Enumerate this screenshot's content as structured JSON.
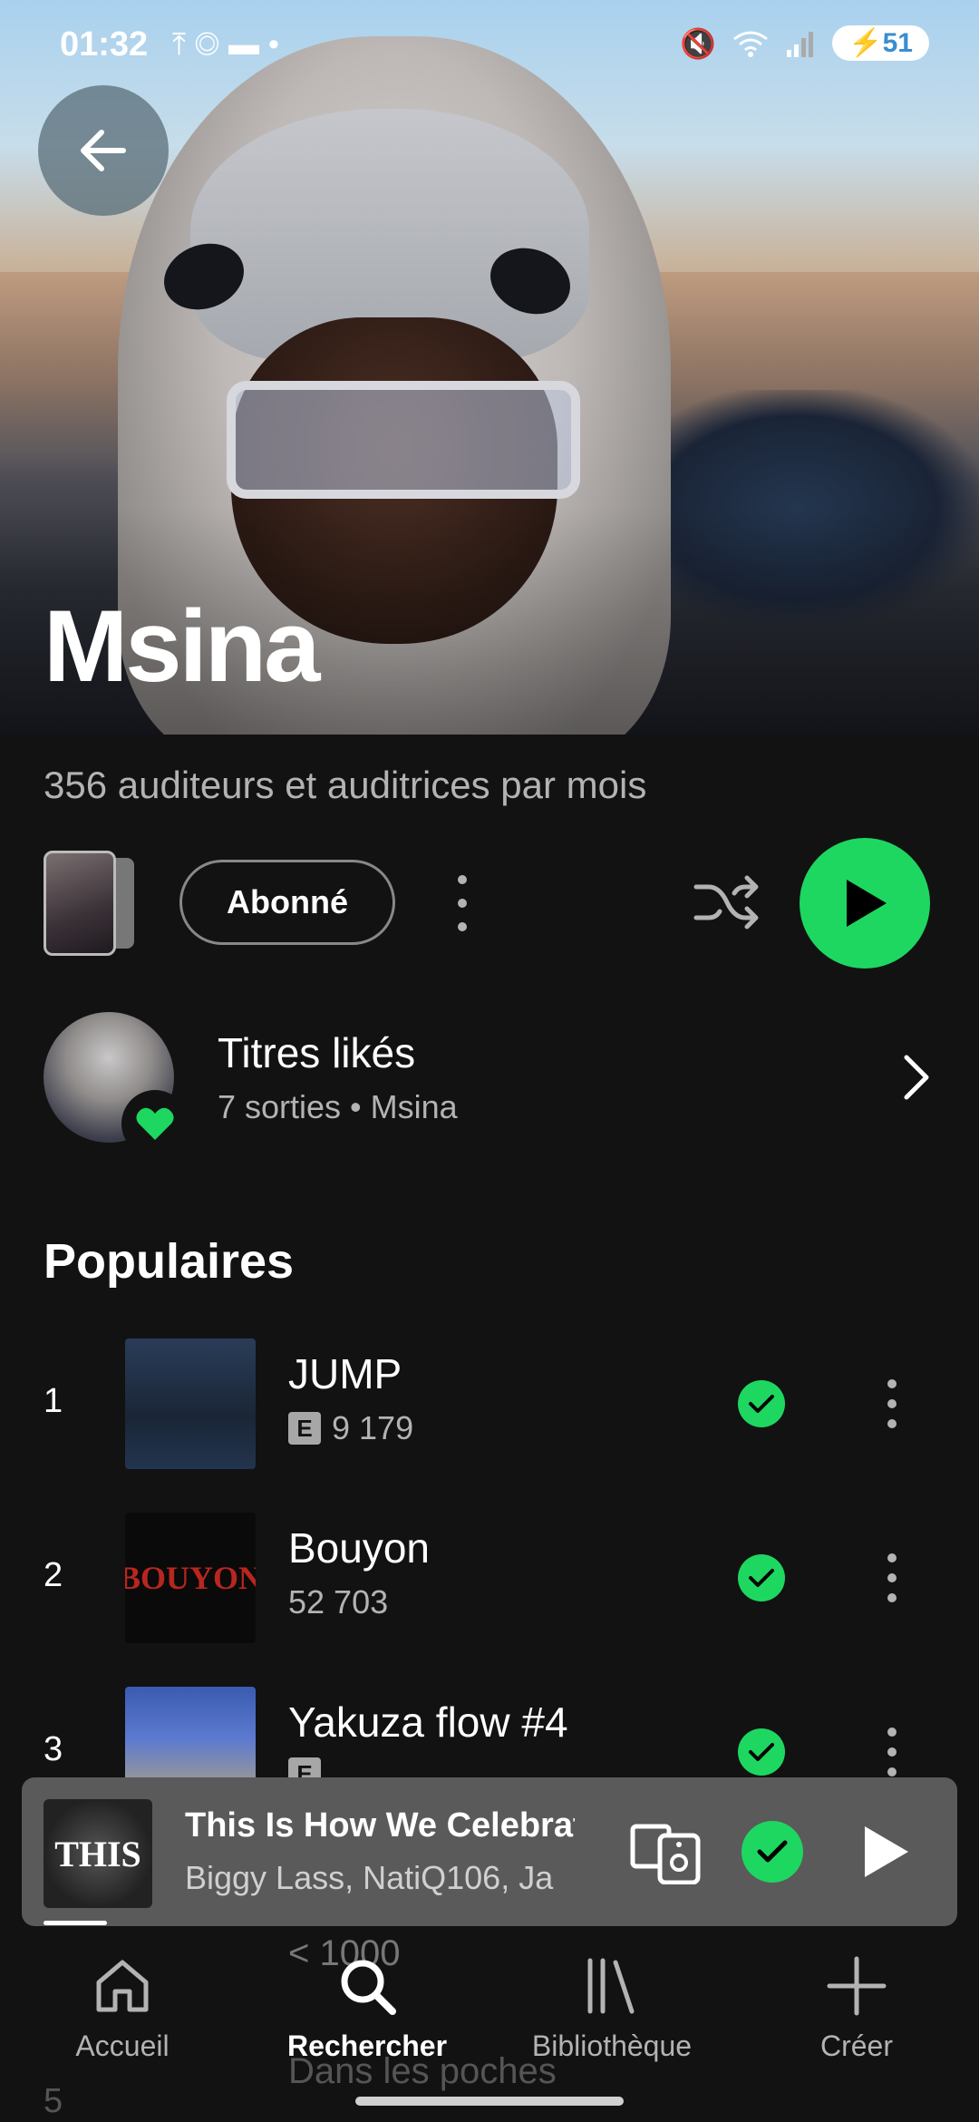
{
  "status_bar": {
    "time": "01:32",
    "battery": "51",
    "icons": [
      "upload-icon",
      "instagram-icon",
      "folder-icon",
      "dot-icon",
      "mute-icon",
      "wifi-icon",
      "signal-icon",
      "battery-charging-icon"
    ]
  },
  "artist": {
    "name": "Msina",
    "monthly_listeners": "356 auditeurs et auditrices par mois"
  },
  "actions": {
    "follow_label": "Abonné",
    "accent_color": "#1ed760"
  },
  "liked": {
    "title": "Titres likés",
    "subtitle": "7 sorties • Msina"
  },
  "popular": {
    "title": "Populaires",
    "tracks": [
      {
        "num": "1",
        "title": "JUMP",
        "explicit": true,
        "plays": "9 179"
      },
      {
        "num": "2",
        "title": "Bouyon",
        "explicit": false,
        "plays": "52 703",
        "art_text": "BOUYON"
      },
      {
        "num": "3",
        "title": "Yakuza flow #4",
        "explicit": true,
        "plays": ""
      }
    ],
    "hidden_track_plays": "< 1000",
    "hidden_track_title": "Dans les poches",
    "hidden_track_num": "5"
  },
  "now_playing": {
    "title": "This Is How We Celebrat",
    "artists": "Biggy Lass, NatiQ106, Ja",
    "art_text": "THIS",
    "progress": 0.07
  },
  "nav": [
    {
      "label": "Accueil",
      "icon": "home-icon",
      "active": false
    },
    {
      "label": "Rechercher",
      "icon": "search-icon",
      "active": true
    },
    {
      "label": "Bibliothèque",
      "icon": "library-icon",
      "active": false
    },
    {
      "label": "Créer",
      "icon": "plus-icon",
      "active": false
    }
  ]
}
